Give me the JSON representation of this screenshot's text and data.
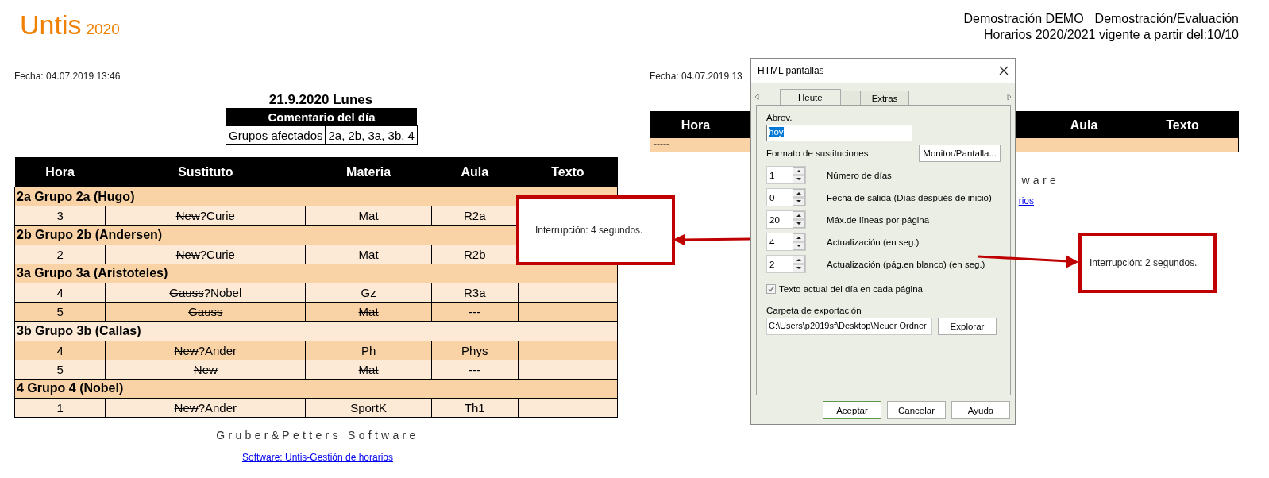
{
  "logo": {
    "name": "Untis",
    "version": "2020"
  },
  "header_info": {
    "school": "Demostración DEMO",
    "license": "Demostración/Evaluación",
    "schedule": "Horarios 2020/2021 vigente a partir del:10/10"
  },
  "left_page": {
    "date": "Fecha: 04.07.2019 13:46",
    "day_title": "21.9.2020 Lunes",
    "day_comment": {
      "title": "Comentario del día",
      "label": "Grupos afectados",
      "value": "2a, 2b, 3a, 3b, 4"
    },
    "table": {
      "columns": [
        "Hora",
        "Sustituto",
        "Materia",
        "Aula",
        "Texto"
      ],
      "groups": [
        {
          "title": "2a Grupo 2a (Hugo)",
          "rows": [
            {
              "hora": "3",
              "substitute": {
                "original": "New",
                "replacement": "?Curie"
              },
              "materia": {
                "text": "Mat",
                "cancelled": false
              },
              "aula": "R2a"
            }
          ]
        },
        {
          "title": "2b Grupo 2b (Andersen)",
          "rows": [
            {
              "hora": "2",
              "substitute": {
                "original": "New",
                "replacement": "?Curie"
              },
              "materia": {
                "text": "Mat",
                "cancelled": false
              },
              "aula": "R2b"
            }
          ]
        },
        {
          "title": "3a Grupo 3a (Aristoteles)",
          "rows": [
            {
              "hora": "4",
              "substitute": {
                "original": "Gauss",
                "replacement": "?Nobel"
              },
              "materia": {
                "text": "Gz",
                "cancelled": false
              },
              "aula": "R3a"
            },
            {
              "hora": "5",
              "substitute": {
                "original": "Gauss"
              },
              "materia": {
                "text": "Mat",
                "cancelled": true
              },
              "aula": "---"
            }
          ]
        },
        {
          "title": "3b Grupo 3b (Callas)",
          "rows": [
            {
              "hora": "4",
              "substitute": {
                "original": "New",
                "replacement": "?Ander"
              },
              "materia": {
                "text": "Ph",
                "cancelled": false
              },
              "aula": "Phys"
            },
            {
              "hora": "5",
              "substitute": {
                "original": "New"
              },
              "materia": {
                "text": "Mat",
                "cancelled": true
              },
              "aula": "---"
            }
          ]
        },
        {
          "title": "4 Grupo 4 (Nobel)",
          "rows": [
            {
              "hora": "1",
              "substitute": {
                "original": "New",
                "replacement": "?Ander"
              },
              "materia": {
                "text": "SportK",
                "cancelled": false
              },
              "aula": "Th1"
            }
          ]
        }
      ]
    },
    "footer": "Gruber&Petters Software",
    "link": "Software: Untis-Gestión de horarios"
  },
  "right_page": {
    "date": "Fecha: 04.07.2019 13",
    "table": {
      "columns": [
        "Hora",
        "Aula",
        "Texto"
      ],
      "rows": [
        "-----"
      ]
    },
    "footer": "ware",
    "link": "rios"
  },
  "dialog": {
    "title": "HTML pantallas",
    "tabs": [
      {
        "label": "Heute",
        "selected": true
      },
      {
        "selected": false
      },
      {
        "label": "Extras",
        "selected": false
      }
    ],
    "abbreviation": {
      "label": "Abrev.",
      "value": "hoy",
      "selected": true
    },
    "format_label": "Formato de sustituciones",
    "monitor_button": "Monitor/Pantalla...",
    "spinners": [
      {
        "value": "1",
        "label": "Número de días"
      },
      {
        "value": "0",
        "label": "Fecha de salida (Días después de inicio)"
      },
      {
        "value": "20",
        "label": "Máx.de líneas por página"
      },
      {
        "value": "4",
        "label": "Actualización (en seg.)"
      },
      {
        "value": "2",
        "label": "Actualización (pág.en blanco) (en seg.)"
      }
    ],
    "checkbox": {
      "label": "Texto actual del día en cada página",
      "checked": true
    },
    "export": {
      "label": "Carpeta de exportación",
      "value": "C:\\Users\\p2019sf\\Desktop\\Neuer Ordner",
      "button": "Explorar"
    },
    "buttons": [
      {
        "label": "Aceptar",
        "default": true
      },
      {
        "label": "Cancelar",
        "default": false
      },
      {
        "label": "Ayuda",
        "default": false
      }
    ]
  },
  "callouts": [
    {
      "text": "Interrupción: 4 segundos."
    },
    {
      "text": "Interrupción: 2 segundos."
    }
  ]
}
